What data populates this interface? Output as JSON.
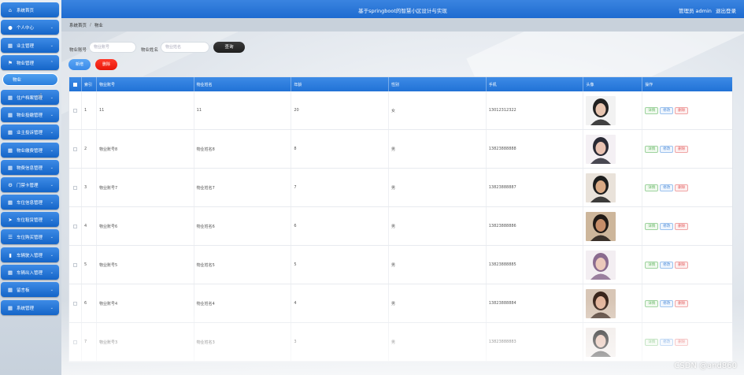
{
  "header": {
    "title": "基于springboot的智慧小区设计与实现",
    "user_label": "管理员 admin",
    "logout_label": "退出登录"
  },
  "breadcrumb": {
    "home": "系统首页",
    "separator": "/",
    "current": "物业"
  },
  "sidebar": {
    "items": [
      {
        "label": "系统首页",
        "icon": "home-icon"
      },
      {
        "label": "个人中心",
        "icon": "user-icon"
      },
      {
        "label": "业主管理",
        "icon": "grid-icon"
      },
      {
        "label": "物业管理",
        "icon": "flag-icon"
      },
      {
        "label": "住户档案管理",
        "icon": "grid-icon"
      },
      {
        "label": "物业投缴管理",
        "icon": "grid-icon"
      },
      {
        "label": "业主投诉管理",
        "icon": "grid-icon"
      },
      {
        "label": "物业缴费管理",
        "icon": "grid-icon"
      },
      {
        "label": "物费信息管理",
        "icon": "grid-icon"
      },
      {
        "label": "门禁卡管理",
        "icon": "gear-icon"
      },
      {
        "label": "车位信息管理",
        "icon": "grid-icon"
      },
      {
        "label": "车位租赁管理",
        "icon": "send-icon"
      },
      {
        "label": "车位购买管理",
        "icon": "list-icon"
      },
      {
        "label": "车辆驶入管理",
        "icon": "bar-chart-icon"
      },
      {
        "label": "车辆出入管理",
        "icon": "grid-icon"
      },
      {
        "label": "留言板",
        "icon": "grid-icon"
      },
      {
        "label": "系统管理",
        "icon": "grid-icon"
      }
    ],
    "active_sub": "物业"
  },
  "search": {
    "account_label": "物业账号",
    "account_placeholder": "物业账号",
    "name_label": "物业姓名",
    "name_placeholder": "物业姓名",
    "query_button": "查询"
  },
  "actions": {
    "add_label": "新增",
    "delete_label": "删除"
  },
  "table": {
    "columns": [
      "索引",
      "物业账号",
      "物业姓名",
      "年龄",
      "性别",
      "手机",
      "头像",
      "操作"
    ],
    "row_actions": {
      "detail": "详情",
      "edit": "修改",
      "delete": "删除"
    },
    "rows": [
      {
        "index": "1",
        "account": "11",
        "name": "11",
        "age": "20",
        "gender": "女",
        "phone": "13012312322"
      },
      {
        "index": "2",
        "account": "物业账号8",
        "name": "物业姓名8",
        "age": "8",
        "gender": "男",
        "phone": "13823888888"
      },
      {
        "index": "3",
        "account": "物业账号7",
        "name": "物业姓名7",
        "age": "7",
        "gender": "男",
        "phone": "13823888887"
      },
      {
        "index": "4",
        "account": "物业账号6",
        "name": "物业姓名6",
        "age": "6",
        "gender": "男",
        "phone": "13823888886"
      },
      {
        "index": "5",
        "account": "物业账号5",
        "name": "物业姓名5",
        "age": "5",
        "gender": "男",
        "phone": "13823888885"
      },
      {
        "index": "6",
        "account": "物业账号4",
        "name": "物业姓名4",
        "age": "4",
        "gender": "男",
        "phone": "13823888884"
      },
      {
        "index": "7",
        "account": "物业账号3",
        "name": "物业姓名3",
        "age": "3",
        "gender": "男",
        "phone": "13823888883"
      }
    ]
  },
  "watermark": "CSDN @and860",
  "colors": {
    "primary": "#2172d6",
    "danger": "#e8170a",
    "dark_button": "#1f1f1f"
  }
}
